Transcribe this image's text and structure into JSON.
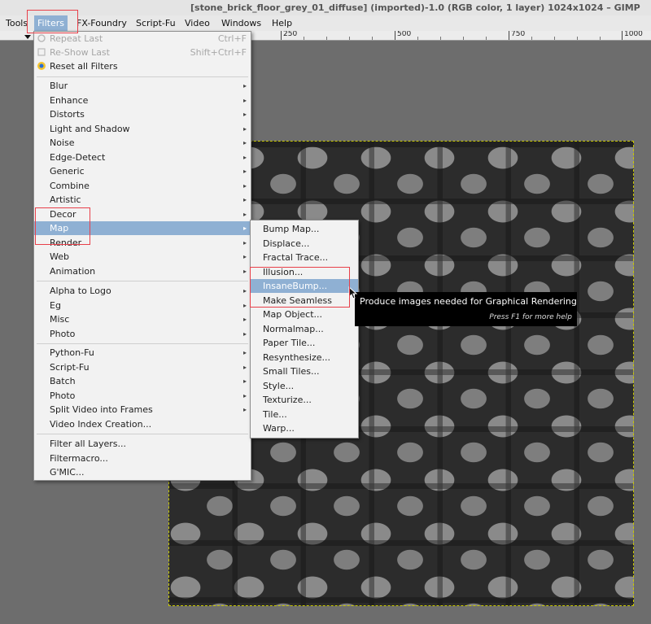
{
  "window": {
    "title": "[stone_brick_floor_grey_01_diffuse] (imported)-1.0 (RGB color, 1 layer) 1024x1024 – GIMP"
  },
  "menubar": [
    {
      "label": "Tools"
    },
    {
      "label": "Filters"
    },
    {
      "label": "FX-Foundry"
    },
    {
      "label": "Script-Fu"
    },
    {
      "label": "Video"
    },
    {
      "label": "Windows"
    },
    {
      "label": "Help"
    }
  ],
  "ruler": {
    "labels": [
      "250",
      "500",
      "750",
      "1000"
    ]
  },
  "filters_menu": {
    "items": [
      {
        "label": "Repeat Last",
        "shortcut": "Ctrl+F",
        "disabled": true
      },
      {
        "label": "Re-Show Last",
        "shortcut": "Shift+Ctrl+F",
        "disabled": true
      },
      {
        "label": "Reset all Filters"
      },
      {
        "label": "Blur"
      },
      {
        "label": "Enhance"
      },
      {
        "label": "Distorts"
      },
      {
        "label": "Light and Shadow"
      },
      {
        "label": "Noise"
      },
      {
        "label": "Edge-Detect"
      },
      {
        "label": "Generic"
      },
      {
        "label": "Combine"
      },
      {
        "label": "Artistic"
      },
      {
        "label": "Decor"
      },
      {
        "label": "Map"
      },
      {
        "label": "Render"
      },
      {
        "label": "Web"
      },
      {
        "label": "Animation"
      },
      {
        "label": "Alpha to Logo"
      },
      {
        "label": "Eg"
      },
      {
        "label": "Misc"
      },
      {
        "label": "Photo"
      },
      {
        "label": "Python-Fu"
      },
      {
        "label": "Script-Fu"
      },
      {
        "label": "Batch"
      },
      {
        "label": "Photo"
      },
      {
        "label": "Split Video into Frames"
      },
      {
        "label": "Video Index Creation..."
      },
      {
        "label": "Filter all Layers..."
      },
      {
        "label": "Filtermacro..."
      },
      {
        "label": "G'MIC..."
      }
    ]
  },
  "map_submenu": {
    "items": [
      {
        "label": "Bump Map..."
      },
      {
        "label": "Displace..."
      },
      {
        "label": "Fractal Trace..."
      },
      {
        "label": "Illusion..."
      },
      {
        "label": "InsaneBump..."
      },
      {
        "label": "Make Seamless"
      },
      {
        "label": "Map Object..."
      },
      {
        "label": "Normalmap..."
      },
      {
        "label": "Paper Tile..."
      },
      {
        "label": "Resynthesize..."
      },
      {
        "label": "Small Tiles..."
      },
      {
        "label": "Style..."
      },
      {
        "label": "Texturize..."
      },
      {
        "label": "Tile..."
      },
      {
        "label": "Warp..."
      }
    ]
  },
  "tooltip": {
    "text": "Produce images needed for Graphical Rendering",
    "help": "Press F1 for more help"
  },
  "colors": {
    "highlight": "#8fb0d3",
    "callout": "#e8404a"
  }
}
